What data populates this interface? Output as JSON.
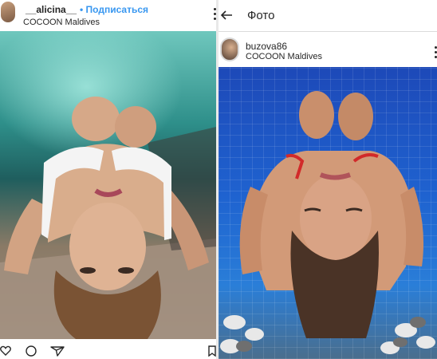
{
  "left_post": {
    "username": "__alicina__",
    "separator": "•",
    "follow_label": "Подписаться",
    "location": "COCOON Maldives"
  },
  "right_post": {
    "topbar_title": "Фото",
    "username": "buzova86",
    "location": "COCOON Maldives"
  },
  "icons": {
    "left_actions": [
      "heart-icon",
      "comment-icon",
      "share-icon",
      "bookmark-icon"
    ],
    "user_tag": "user-tag-icon",
    "back": "back-arrow-icon",
    "more": "more-options-icon"
  },
  "colors": {
    "follow_blue": "#3897f0",
    "text": "#262626",
    "pool_left": "#2e8f8a",
    "pool_right": "#1f63d0"
  }
}
